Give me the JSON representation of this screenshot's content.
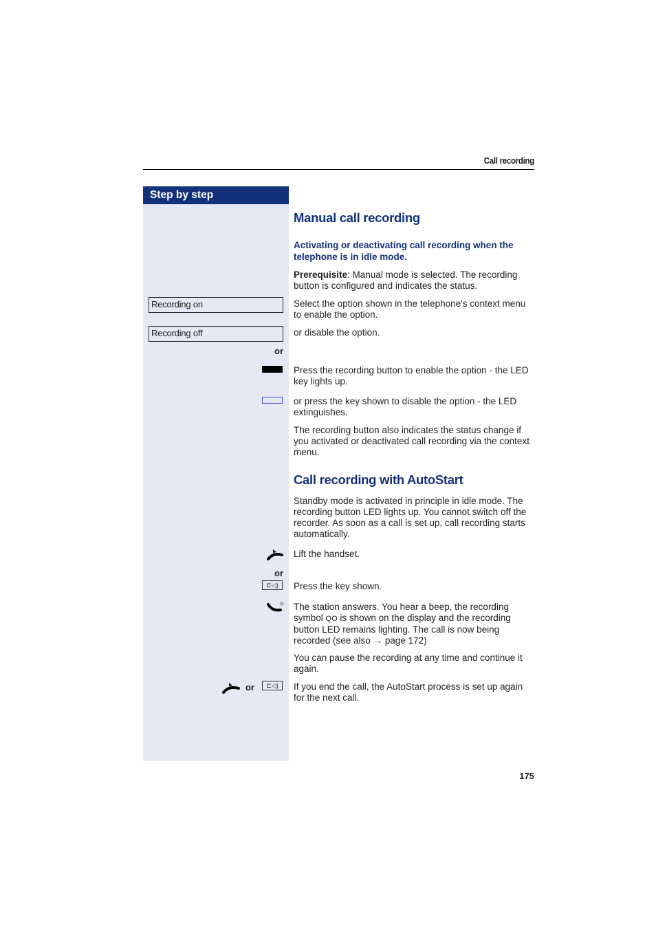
{
  "header": {
    "section_title": "Call recording"
  },
  "sidebar": {
    "title": "Step by step",
    "menu_options": [
      "Recording on",
      "Recording off"
    ],
    "or_label": "or",
    "icons": {
      "recording_key_on": "led-key-lit-icon",
      "recording_key_off": "led-key-off-icon",
      "lift_handset": "handset-lift-icon",
      "speaker_key": "loudspeaker-key-icon",
      "call_answered": "handset-call-icon",
      "hang_up": "handset-hangup-icon"
    },
    "speaker_glyph": "⊏◁)",
    "handset_glyph": "☎"
  },
  "main": {
    "section1": {
      "title": "Manual call recording",
      "subtitle": "Activating or deactivating call recording when the telephone is in idle mode.",
      "prerequisite_label": "Prerequisite",
      "prerequisite_text": ": Manual mode is selected. The recording button is configured and indicates the status.",
      "step_on": "Select the option shown in the telephone's context menu to enable the option.",
      "step_off": "or disable the option.",
      "step_key_on": "Press the recording button to enable the option - the LED key lights up.",
      "step_key_off": "or press the key shown to disable the option - the LED extinguishes.",
      "note": "The recording button also indicates the status change if you activated or deactivated call recording via the context menu."
    },
    "section2": {
      "title": "Call recording with AutoStart",
      "intro": "Standby mode is activated in principle in idle mode. The recording button LED lights up. You cannot switch off the recorder. As soon as a call is set up, call recording starts automatically.",
      "step_lift": "Lift the handset.",
      "step_key": "Press the key shown.",
      "step_answer_a": "The station answers. You hear a beep, the recording symbol ",
      "recording_symbol": "QO",
      "step_answer_b": " is shown on the display and the recording button LED remains lighting. The call is now being recorded (see also ",
      "arrow": "→",
      "page_ref": " page 172)",
      "pause_note": "You can pause the recording at any time and continue it again.",
      "end_note": "If you end the call, the AutoStart process is set up again for the next call."
    }
  },
  "footer": {
    "page_number": "175"
  }
}
